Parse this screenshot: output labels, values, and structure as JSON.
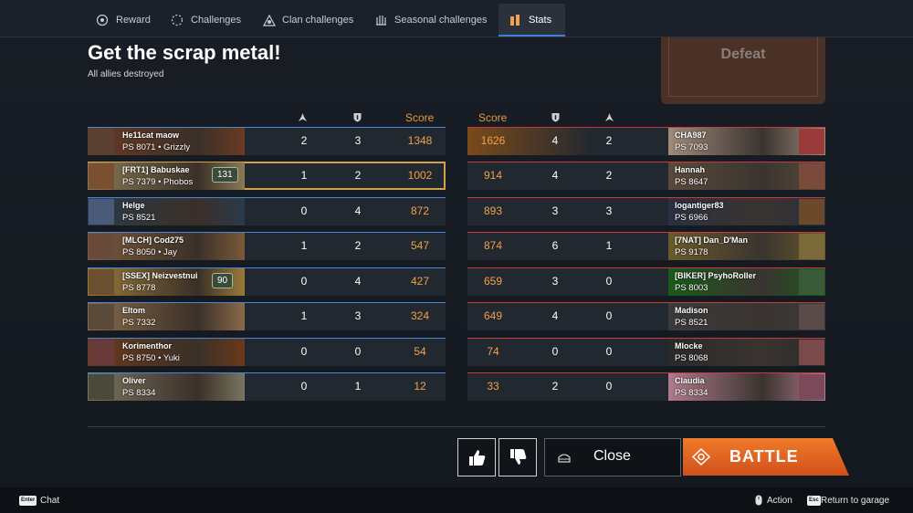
{
  "tabs": [
    {
      "label": "Reward",
      "icon": "reward-icon",
      "active": false
    },
    {
      "label": "Challenges",
      "icon": "challenges-icon",
      "active": false
    },
    {
      "label": "Clan challenges",
      "icon": "clan-challenges-icon",
      "active": false
    },
    {
      "label": "Seasonal challenges",
      "icon": "seasonal-challenges-icon",
      "active": false
    },
    {
      "label": "Stats",
      "icon": "stats-icon",
      "active": true
    }
  ],
  "mission": {
    "title": "Get the scrap metal!",
    "subtitle": "All allies destroyed"
  },
  "result": {
    "label": "Defeat"
  },
  "headers": {
    "score_left": "Score",
    "score_right": "Score"
  },
  "allies": [
    {
      "name": "He11cat maow",
      "ps": "PS 8071",
      "squadmate": "Grizzly",
      "kills": "2",
      "assists": "3",
      "score": "1348"
    },
    {
      "name": "[FRT1] Babuskae",
      "ps": "PS 7379",
      "squadmate": "Phobos",
      "badge": "131",
      "kills": "1",
      "assists": "2",
      "score": "1002",
      "is_player": true
    },
    {
      "name": "Helge",
      "ps": "PS 8521",
      "kills": "0",
      "assists": "4",
      "score": "872"
    },
    {
      "name": "[MLCH] Cod275",
      "ps": "PS 8050",
      "squadmate": "Jay",
      "kills": "1",
      "assists": "2",
      "score": "547"
    },
    {
      "name": "[SSEX] Neizvestnui",
      "ps": "PS 8778",
      "badge": "90",
      "kills": "0",
      "assists": "4",
      "score": "427"
    },
    {
      "name": "Eltom",
      "ps": "PS 7332",
      "kills": "1",
      "assists": "3",
      "score": "324"
    },
    {
      "name": "Korimenthor",
      "ps": "PS 8750",
      "squadmate": "Yuki",
      "kills": "0",
      "assists": "0",
      "score": "54"
    },
    {
      "name": "Oliver",
      "ps": "PS 8334",
      "kills": "0",
      "assists": "1",
      "score": "12"
    }
  ],
  "enemies": [
    {
      "name": "CHA987",
      "ps": "PS 7093",
      "score": "1626",
      "assists": "4",
      "kills": "2"
    },
    {
      "name": "Hannah",
      "ps": "PS 8647",
      "score": "914",
      "assists": "4",
      "kills": "2"
    },
    {
      "name": "logantiger83",
      "ps": "PS 6966",
      "score": "893",
      "assists": "3",
      "kills": "3"
    },
    {
      "name": "[7NAT] Dan_D'Man",
      "ps": "PS 9178",
      "score": "874",
      "assists": "6",
      "kills": "1"
    },
    {
      "name": "[BIKER] PsyhoRoller",
      "ps": "PS 8003",
      "score": "659",
      "assists": "3",
      "kills": "0"
    },
    {
      "name": "Madison",
      "ps": "PS 8521",
      "score": "649",
      "assists": "4",
      "kills": "0"
    },
    {
      "name": "Mlocke",
      "ps": "PS 8068",
      "score": "74",
      "assists": "0",
      "kills": "0"
    },
    {
      "name": "Claudia",
      "ps": "PS 8334",
      "score": "33",
      "assists": "2",
      "kills": "0"
    }
  ],
  "buttons": {
    "like": "thumbs-up-icon",
    "dislike": "thumbs-down-icon",
    "close": "Close",
    "battle": "BATTLE"
  },
  "footer": {
    "chat_key": "Enter",
    "chat": "Chat",
    "action": "Action",
    "return_key": "Esc",
    "return": "Return to garage"
  },
  "colors": {
    "ally": "#4a86d6",
    "enemy": "#c83b3b",
    "score": "#f0a14a",
    "battle": "#e0601a",
    "highlight": "#d2a24a"
  }
}
